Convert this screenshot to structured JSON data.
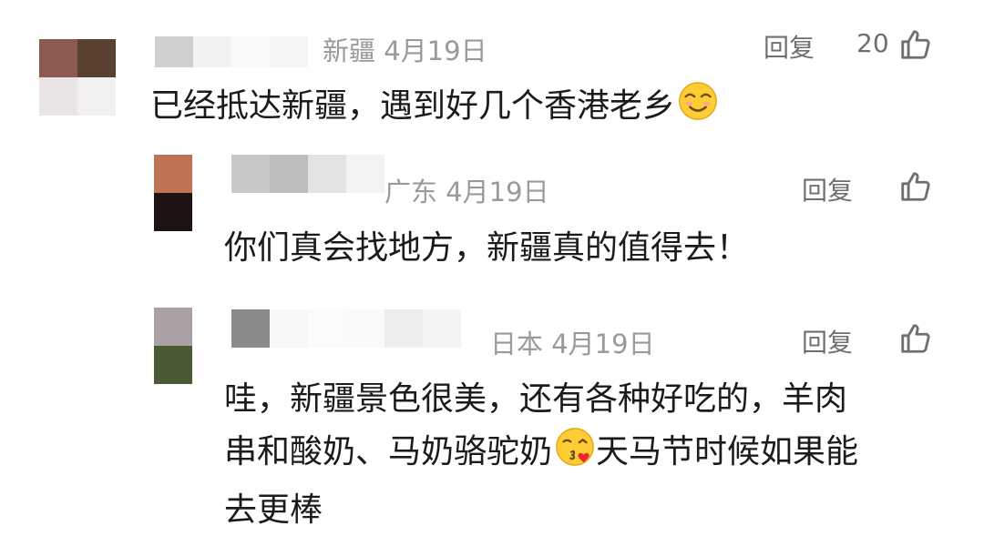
{
  "comments": [
    {
      "username_obscured": true,
      "location": "新疆",
      "date": "4月19日",
      "reply_label": "回复",
      "likes": "20",
      "like_icon": "thumbs-up-icon",
      "text": "已经抵达新疆，遇到好几个香港老乡",
      "emoji": "smiling-face-icon",
      "avatar_colors": [
        "#8c5a52",
        "#5a4030",
        "#eae4e4",
        "#f3f0f0"
      ]
    },
    {
      "username_obscured": true,
      "location": "广东",
      "date": "4月19日",
      "reply_label": "回复",
      "likes": "",
      "like_icon": "thumbs-up-icon",
      "text": "你们真会找地方，新疆真的值得去！",
      "avatar_colors": [
        "#c07254",
        "#1f1212"
      ]
    },
    {
      "username_obscured": true,
      "location": "日本",
      "date": "4月19日",
      "reply_label": "回复",
      "likes": "",
      "like_icon": "thumbs-up-icon",
      "text_line1": "哇，新疆景色很美，还有各种好吃的，羊肉",
      "text_line2_a": "串和酸奶、马奶骆驼奶",
      "emoji": "kissing-face-heart-icon",
      "text_line2_b": "天马节时候如果能",
      "text_line3": "去更棒",
      "avatar_colors": [
        "#aaa0a6",
        "#4a5a32"
      ]
    }
  ]
}
